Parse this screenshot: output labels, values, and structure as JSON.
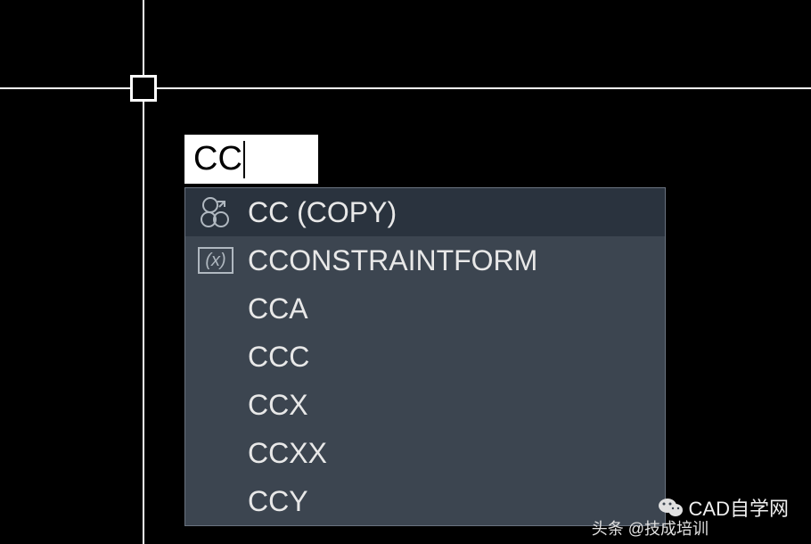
{
  "command_input": {
    "value": "CC"
  },
  "autocomplete": {
    "items": [
      {
        "label": "CC (COPY)",
        "icon": "copy",
        "selected": true
      },
      {
        "label": "CCONSTRAINTFORM",
        "icon": "variable",
        "selected": false
      },
      {
        "label": "CCA",
        "icon": "none",
        "selected": false
      },
      {
        "label": "CCC",
        "icon": "none",
        "selected": false
      },
      {
        "label": "CCX",
        "icon": "none",
        "selected": false
      },
      {
        "label": "CCXX",
        "icon": "none",
        "selected": false
      },
      {
        "label": "CCY",
        "icon": "none",
        "selected": false
      }
    ]
  },
  "watermark": {
    "right": "CAD自学网",
    "bottom": "头条 @技成培训"
  }
}
